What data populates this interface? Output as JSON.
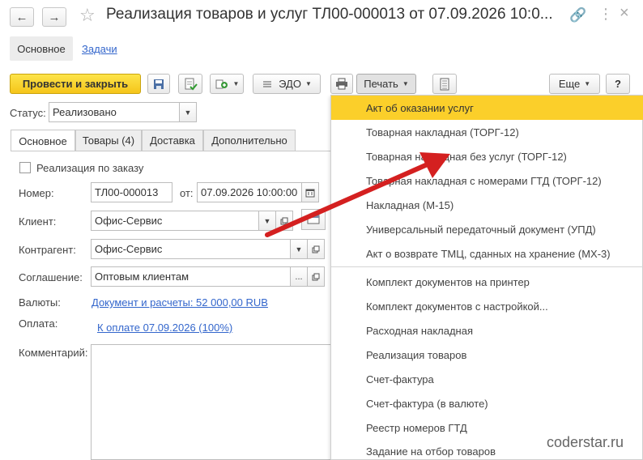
{
  "header": {
    "back_icon": "←",
    "forward_icon": "→",
    "star_icon": "☆",
    "title": "Реализация товаров и услуг ТЛ00-000013 от 07.09.2026 10:0...",
    "link_icon": "🔗",
    "more_icon": "⋮",
    "close_icon": "×"
  },
  "nav_tabs": {
    "main": "Основное",
    "tasks": "Задачи"
  },
  "toolbar": {
    "post_close": "Провести и закрыть",
    "edo": "ЭДО",
    "print": "Печать",
    "more": "Еще",
    "help": "?"
  },
  "status": {
    "label": "Статус:",
    "value": "Реализовано"
  },
  "form_tabs": [
    "Основное",
    "Товары (4)",
    "Доставка",
    "Дополнительно"
  ],
  "form": {
    "by_order": "Реализация по заказу",
    "number_label": "Номер:",
    "number_value": "ТЛ00-000013",
    "date_label": "от:",
    "date_value": "07.09.2026 10:00:00",
    "client_label": "Клиент:",
    "client_value": "Офис-Сервис",
    "counterparty_label": "Контрагент:",
    "counterparty_value": "Офис-Сервис",
    "agreement_label": "Соглашение:",
    "agreement_value": "Оптовым клиентам",
    "currency_label": "Валюты:",
    "currency_link": "Документ и расчеты: 52 000,00 RUB",
    "payment_label": "Оплата:",
    "payment_link": "К оплате 07.09.2026 (100%)",
    "comment_label": "Комментарий:"
  },
  "print_menu": {
    "group1": [
      "Акт об оказании услуг",
      "Товарная накладная (ТОРГ-12)",
      "Товарная накладная без услуг (ТОРГ-12)",
      "Товарная накладная с номерами ГТД (ТОРГ-12)",
      "Накладная (М-15)",
      "Универсальный передаточный документ (УПД)",
      "Акт о возврате ТМЦ, сданных на хранение (МХ-3)"
    ],
    "group2": [
      "Комплект документов на принтер",
      "Комплект документов с настройкой...",
      "Расходная накладная",
      "Реализация товаров",
      "Счет-фактура",
      "Счет-фактура (в валюте)",
      "Реестр номеров ГТД",
      "Задание на отбор товаров"
    ]
  },
  "colors": {
    "accent": "#f5c51a",
    "highlight": "#fbcf2a",
    "link": "#3366cc",
    "arrow": "#d42020"
  },
  "watermark": "coderstar.ru"
}
